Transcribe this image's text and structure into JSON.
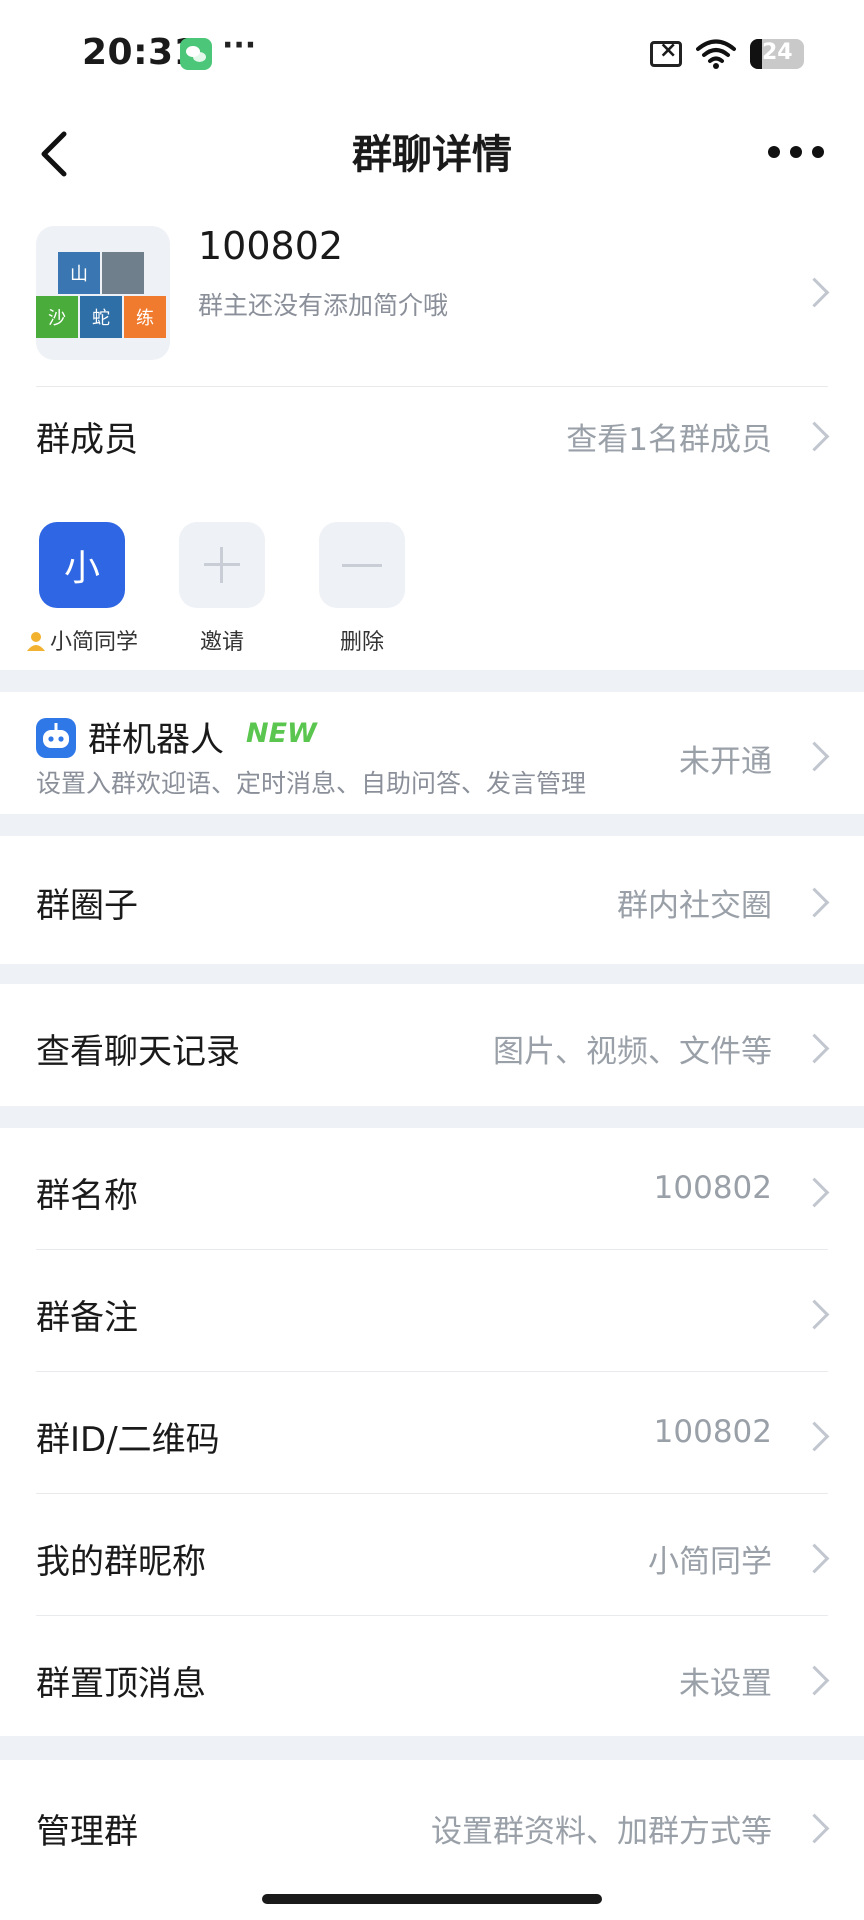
{
  "status_bar": {
    "time": "20:31",
    "more": "···",
    "battery_level": "24"
  },
  "nav": {
    "title": "群聊详情"
  },
  "group": {
    "name": "100802",
    "description": "群主还没有添加简介哦",
    "avatar_tiles": [
      "山",
      "",
      "沙",
      "蛇",
      "练"
    ]
  },
  "members": {
    "label": "群成员",
    "view_all": "查看1名群成员",
    "list": [
      {
        "avatar_char": "小",
        "name": "小简同学",
        "is_owner": true
      }
    ],
    "invite_label": "邀请",
    "delete_label": "删除"
  },
  "bot": {
    "title": "群机器人",
    "badge": "NEW",
    "description": "设置入群欢迎语、定时消息、自助问答、发言管理",
    "status": "未开通"
  },
  "circle": {
    "label": "群圈子",
    "value": "群内社交圈"
  },
  "history": {
    "label": "查看聊天记录",
    "value": "图片、视频、文件等"
  },
  "settings": [
    {
      "label": "群名称",
      "value": "100802"
    },
    {
      "label": "群备注",
      "value": ""
    },
    {
      "label": "群ID/二维码",
      "value": "100802"
    },
    {
      "label": "我的群昵称",
      "value": "小简同学"
    },
    {
      "label": "群置顶消息",
      "value": "未设置"
    }
  ],
  "manage": {
    "label": "管理群",
    "value": "设置群资料、加群方式等"
  },
  "colors": {
    "accent_blue": "#2f66e3",
    "new_badge_green": "#5bc64f",
    "secondary_text": "#9aa0a8",
    "page_background": "#eef2f6"
  }
}
